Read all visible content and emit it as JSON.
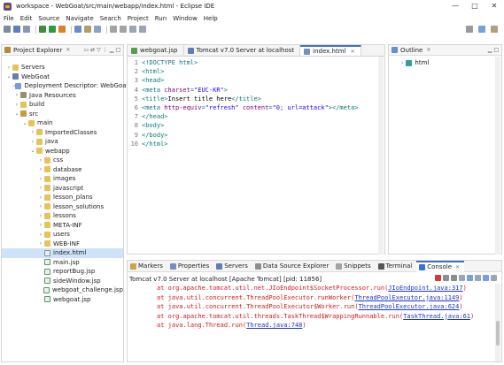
{
  "window": {
    "title": "workspace - WebGoat/src/main/webapp/index.html - Eclipse IDE",
    "controls": [
      "—",
      "□",
      "✕"
    ]
  },
  "menu": [
    "File",
    "Edit",
    "Source",
    "Navigate",
    "Search",
    "Project",
    "Run",
    "Window",
    "Help"
  ],
  "project_explorer": {
    "title": "Project Explorer",
    "tree": [
      {
        "label": "Servers",
        "indent": 0,
        "arrow": "›",
        "icon": "folder"
      },
      {
        "label": "WebGoat",
        "indent": 0,
        "arrow": "⌄",
        "icon": "proj"
      },
      {
        "label": "Deployment Descriptor: WebGoat",
        "indent": 1,
        "arrow": "›",
        "icon": "dd"
      },
      {
        "label": "Java Resources",
        "indent": 1,
        "arrow": "›",
        "icon": "jr"
      },
      {
        "label": "build",
        "indent": 1,
        "arrow": "›",
        "icon": "folder"
      },
      {
        "label": "src",
        "indent": 1,
        "arrow": "⌄",
        "icon": "src"
      },
      {
        "label": "main",
        "indent": 2,
        "arrow": "⌄",
        "icon": "folder"
      },
      {
        "label": "ImportedClasses",
        "indent": 3,
        "arrow": "›",
        "icon": "folder"
      },
      {
        "label": "java",
        "indent": 3,
        "arrow": "›",
        "icon": "folder"
      },
      {
        "label": "webapp",
        "indent": 3,
        "arrow": "⌄",
        "icon": "folder"
      },
      {
        "label": "css",
        "indent": 4,
        "arrow": "›",
        "icon": "folder"
      },
      {
        "label": "database",
        "indent": 4,
        "arrow": "›",
        "icon": "folder"
      },
      {
        "label": "images",
        "indent": 4,
        "arrow": "›",
        "icon": "folder"
      },
      {
        "label": "javascript",
        "indent": 4,
        "arrow": "›",
        "icon": "folder"
      },
      {
        "label": "lesson_plans",
        "indent": 4,
        "arrow": "›",
        "icon": "folder"
      },
      {
        "label": "lesson_solutions",
        "indent": 4,
        "arrow": "›",
        "icon": "folder"
      },
      {
        "label": "lessons",
        "indent": 4,
        "arrow": "›",
        "icon": "folder"
      },
      {
        "label": "META-INF",
        "indent": 4,
        "arrow": "›",
        "icon": "folder"
      },
      {
        "label": "users",
        "indent": 4,
        "arrow": "›",
        "icon": "folder"
      },
      {
        "label": "WEB-INF",
        "indent": 4,
        "arrow": "›",
        "icon": "folder"
      },
      {
        "label": "index.html",
        "indent": 4,
        "arrow": "",
        "icon": "file",
        "selected": true
      },
      {
        "label": "main.jsp",
        "indent": 4,
        "arrow": "",
        "icon": "jsp"
      },
      {
        "label": "reportBug.jsp",
        "indent": 4,
        "arrow": "",
        "icon": "jsp"
      },
      {
        "label": "sideWindow.jsp",
        "indent": 4,
        "arrow": "",
        "icon": "jsp"
      },
      {
        "label": "webgoat_challenge.jsp",
        "indent": 4,
        "arrow": "",
        "icon": "jsp"
      },
      {
        "label": "webgoat.jsp",
        "indent": 4,
        "arrow": "",
        "icon": "jsp"
      }
    ]
  },
  "editor": {
    "tabs": [
      {
        "label": "webgoat.jsp",
        "active": false,
        "icon": "jsp"
      },
      {
        "label": "Tomcat v7.0 Server at localhost",
        "active": false,
        "icon": "server"
      },
      {
        "label": "index.html",
        "active": true,
        "icon": "file"
      }
    ],
    "lines": [
      {
        "n": "1",
        "parts": [
          [
            "tag",
            "<!DOCTYPE html>"
          ]
        ]
      },
      {
        "n": "2",
        "parts": [
          [
            "tag",
            "<html>"
          ]
        ]
      },
      {
        "n": "3",
        "parts": [
          [
            "tag",
            "<head>"
          ]
        ]
      },
      {
        "n": "4",
        "parts": [
          [
            "tag",
            "<meta "
          ],
          [
            "attr",
            "charset"
          ],
          [
            "tag",
            "="
          ],
          [
            "aval",
            "\"EUC-KR\""
          ],
          [
            "tag",
            ">"
          ]
        ]
      },
      {
        "n": "5",
        "parts": [
          [
            "tag",
            "<title>"
          ],
          [
            "ctext",
            "Insert title here"
          ],
          [
            "tag",
            "</title>"
          ]
        ]
      },
      {
        "n": "6",
        "parts": [
          [
            "tag",
            "<meta "
          ],
          [
            "attr",
            "http-equiv"
          ],
          [
            "tag",
            "="
          ],
          [
            "aval",
            "\"refresh\""
          ],
          [
            "tag",
            " "
          ],
          [
            "attr",
            "content"
          ],
          [
            "tag",
            "="
          ],
          [
            "aval",
            "\"0; url=attack\""
          ],
          [
            "tag",
            "></meta>"
          ]
        ]
      },
      {
        "n": "7",
        "parts": [
          [
            "tag",
            "</head>"
          ]
        ]
      },
      {
        "n": "8",
        "parts": [
          [
            "tag",
            "<body>"
          ]
        ]
      },
      {
        "n": "9",
        "parts": [
          [
            "tag",
            "</body>"
          ]
        ]
      },
      {
        "n": "10",
        "parts": [
          [
            "tag",
            "</html>"
          ]
        ]
      }
    ]
  },
  "outline": {
    "title": "Outline",
    "root": "html"
  },
  "bottom": {
    "tabs": [
      {
        "label": "Markers",
        "active": false
      },
      {
        "label": "Properties",
        "active": false
      },
      {
        "label": "Servers",
        "active": false
      },
      {
        "label": "Data Source Explorer",
        "active": false
      },
      {
        "label": "Snippets",
        "active": false
      },
      {
        "label": "Terminal",
        "active": false
      },
      {
        "label": "Console",
        "active": true
      }
    ],
    "console_header": "Tomcat v7.0 Server at localhost [Apache Tomcat]  [pid: 11856]",
    "lines": [
      {
        "pre": "at org.apache.tomcat.util.net.JIoEndpoint$SocketProcessor.run(",
        "link": "JIoEndpoint.java:317",
        "post": ")"
      },
      {
        "pre": "at java.util.concurrent.ThreadPoolExecutor.runWorker(",
        "link": "ThreadPoolExecutor.java:1149",
        "post": ")"
      },
      {
        "pre": "at java.util.concurrent.ThreadPoolExecutor$Worker.run(",
        "link": "ThreadPoolExecutor.java:624",
        "post": ")"
      },
      {
        "pre": "at org.apache.tomcat.util.threads.TaskThread$WrappingRunnable.run(",
        "link": "TaskThread.java:61",
        "post": ")"
      },
      {
        "pre": "at java.lang.Thread.run(",
        "link": "Thread.java:748",
        "post": ")"
      }
    ]
  },
  "colors": {
    "accent": "#3b73c9",
    "selection": "#cfe3f8",
    "console_error": "#d21b1b",
    "link": "#1a35c9"
  }
}
